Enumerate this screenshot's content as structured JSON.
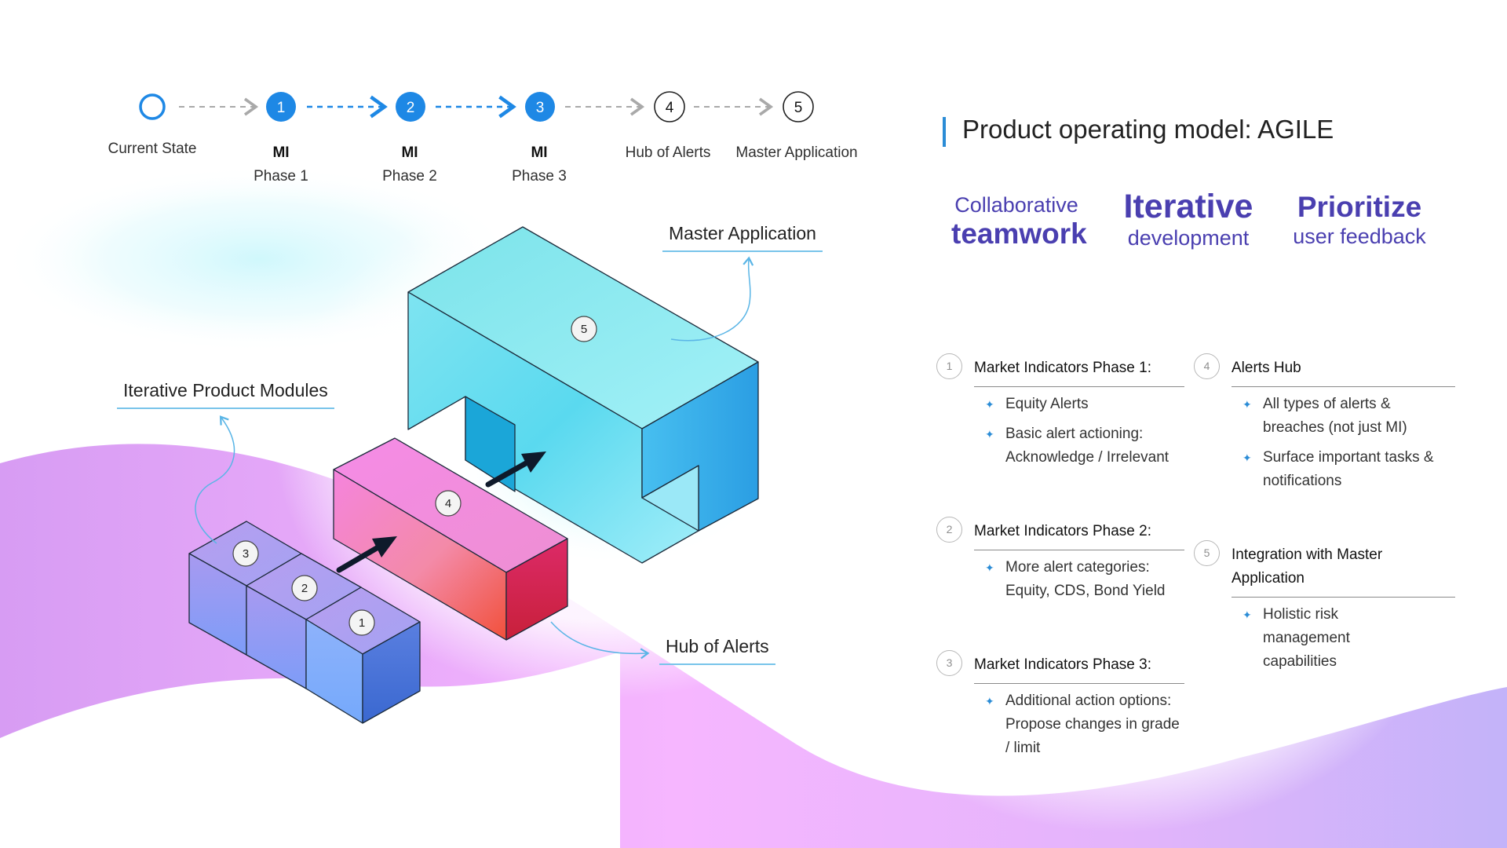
{
  "stepper": {
    "steps": [
      {
        "badge": "",
        "bold": "",
        "label": "Current State",
        "style": "ring"
      },
      {
        "badge": "1",
        "bold": "MI",
        "label": "Phase 1",
        "style": "filled"
      },
      {
        "badge": "2",
        "bold": "MI",
        "label": "Phase 2",
        "style": "filled"
      },
      {
        "badge": "3",
        "bold": "MI",
        "label": "Phase 3",
        "style": "filled"
      },
      {
        "badge": "4",
        "bold": "",
        "label": "Hub of Alerts",
        "style": "outline"
      },
      {
        "badge": "5",
        "bold": "",
        "label": "Master Application",
        "style": "outline"
      }
    ]
  },
  "title": "Product operating model: AGILE",
  "pillars": [
    {
      "line1": "Collaborative",
      "line2": "teamwork"
    },
    {
      "line1": "Iterative",
      "line2": "development"
    },
    {
      "line1": "Prioritize",
      "line2": "user feedback"
    }
  ],
  "sections": [
    {
      "num": "1",
      "heading": "Market Indicators Phase 1:",
      "bullets": [
        "Equity Alerts",
        "Basic alert actioning: Acknowledge / Irrelevant"
      ]
    },
    {
      "num": "2",
      "heading": "Market Indicators Phase 2:",
      "bullets": [
        "More alert categories: Equity, CDS, Bond Yield"
      ]
    },
    {
      "num": "3",
      "heading": "Market Indicators Phase 3:",
      "bullets": [
        "Additional action options: Propose changes in grade / limit"
      ]
    },
    {
      "num": "4",
      "heading": "Alerts Hub",
      "bullets": [
        "All types of alerts & breaches (not just MI)",
        "Surface important tasks & notifications"
      ]
    },
    {
      "num": "5",
      "heading": "Integration with Master Application",
      "bullets": [
        "Holistic risk management capabilities"
      ]
    }
  ],
  "callouts": {
    "master": "Master Application",
    "modules": "Iterative Product Modules",
    "hub": "Hub of Alerts"
  },
  "block_badges": [
    "1",
    "2",
    "3",
    "4",
    "5"
  ],
  "colors": {
    "accent_blue": "#1e88e5",
    "title_bar": "#2b8cd6",
    "pillar_purple": "#4a3fb0",
    "callout_line": "#78c4ea"
  }
}
